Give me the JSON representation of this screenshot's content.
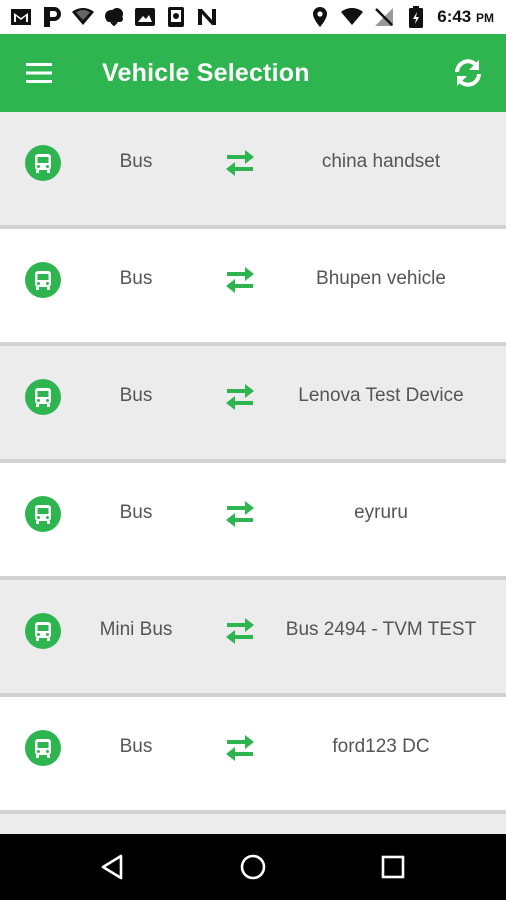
{
  "status_bar": {
    "time": "6:43",
    "ampm": "PM",
    "left_icons": [
      "gmail-icon",
      "parking-icon",
      "wifi-icon",
      "cloud-icon",
      "image-icon",
      "phone-icon",
      "n-icon"
    ],
    "right_icons": [
      "location-icon",
      "wifi-icon",
      "no-signal-icon",
      "battery-icon"
    ]
  },
  "app_bar": {
    "title": "Vehicle Selection",
    "background": "#2eb54f",
    "menu_icon": "hamburger-menu-icon",
    "refresh_icon": "refresh-icon"
  },
  "vehicles": [
    {
      "type": "Bus",
      "name": "china handset"
    },
    {
      "type": "Bus",
      "name": "Bhupen vehicle"
    },
    {
      "type": "Bus",
      "name": "Lenova Test Device"
    },
    {
      "type": "Bus",
      "name": "eyruru"
    },
    {
      "type": "Mini Bus",
      "name": "Bus 2494 - TVM TEST"
    },
    {
      "type": "Bus",
      "name": "ford123 DC"
    }
  ],
  "row_icons": {
    "left": "bus-icon",
    "middle": "swap-arrows-icon"
  },
  "accent_color": "#2eb54f",
  "nav_bar": [
    "back-icon",
    "home-icon",
    "recents-icon"
  ]
}
